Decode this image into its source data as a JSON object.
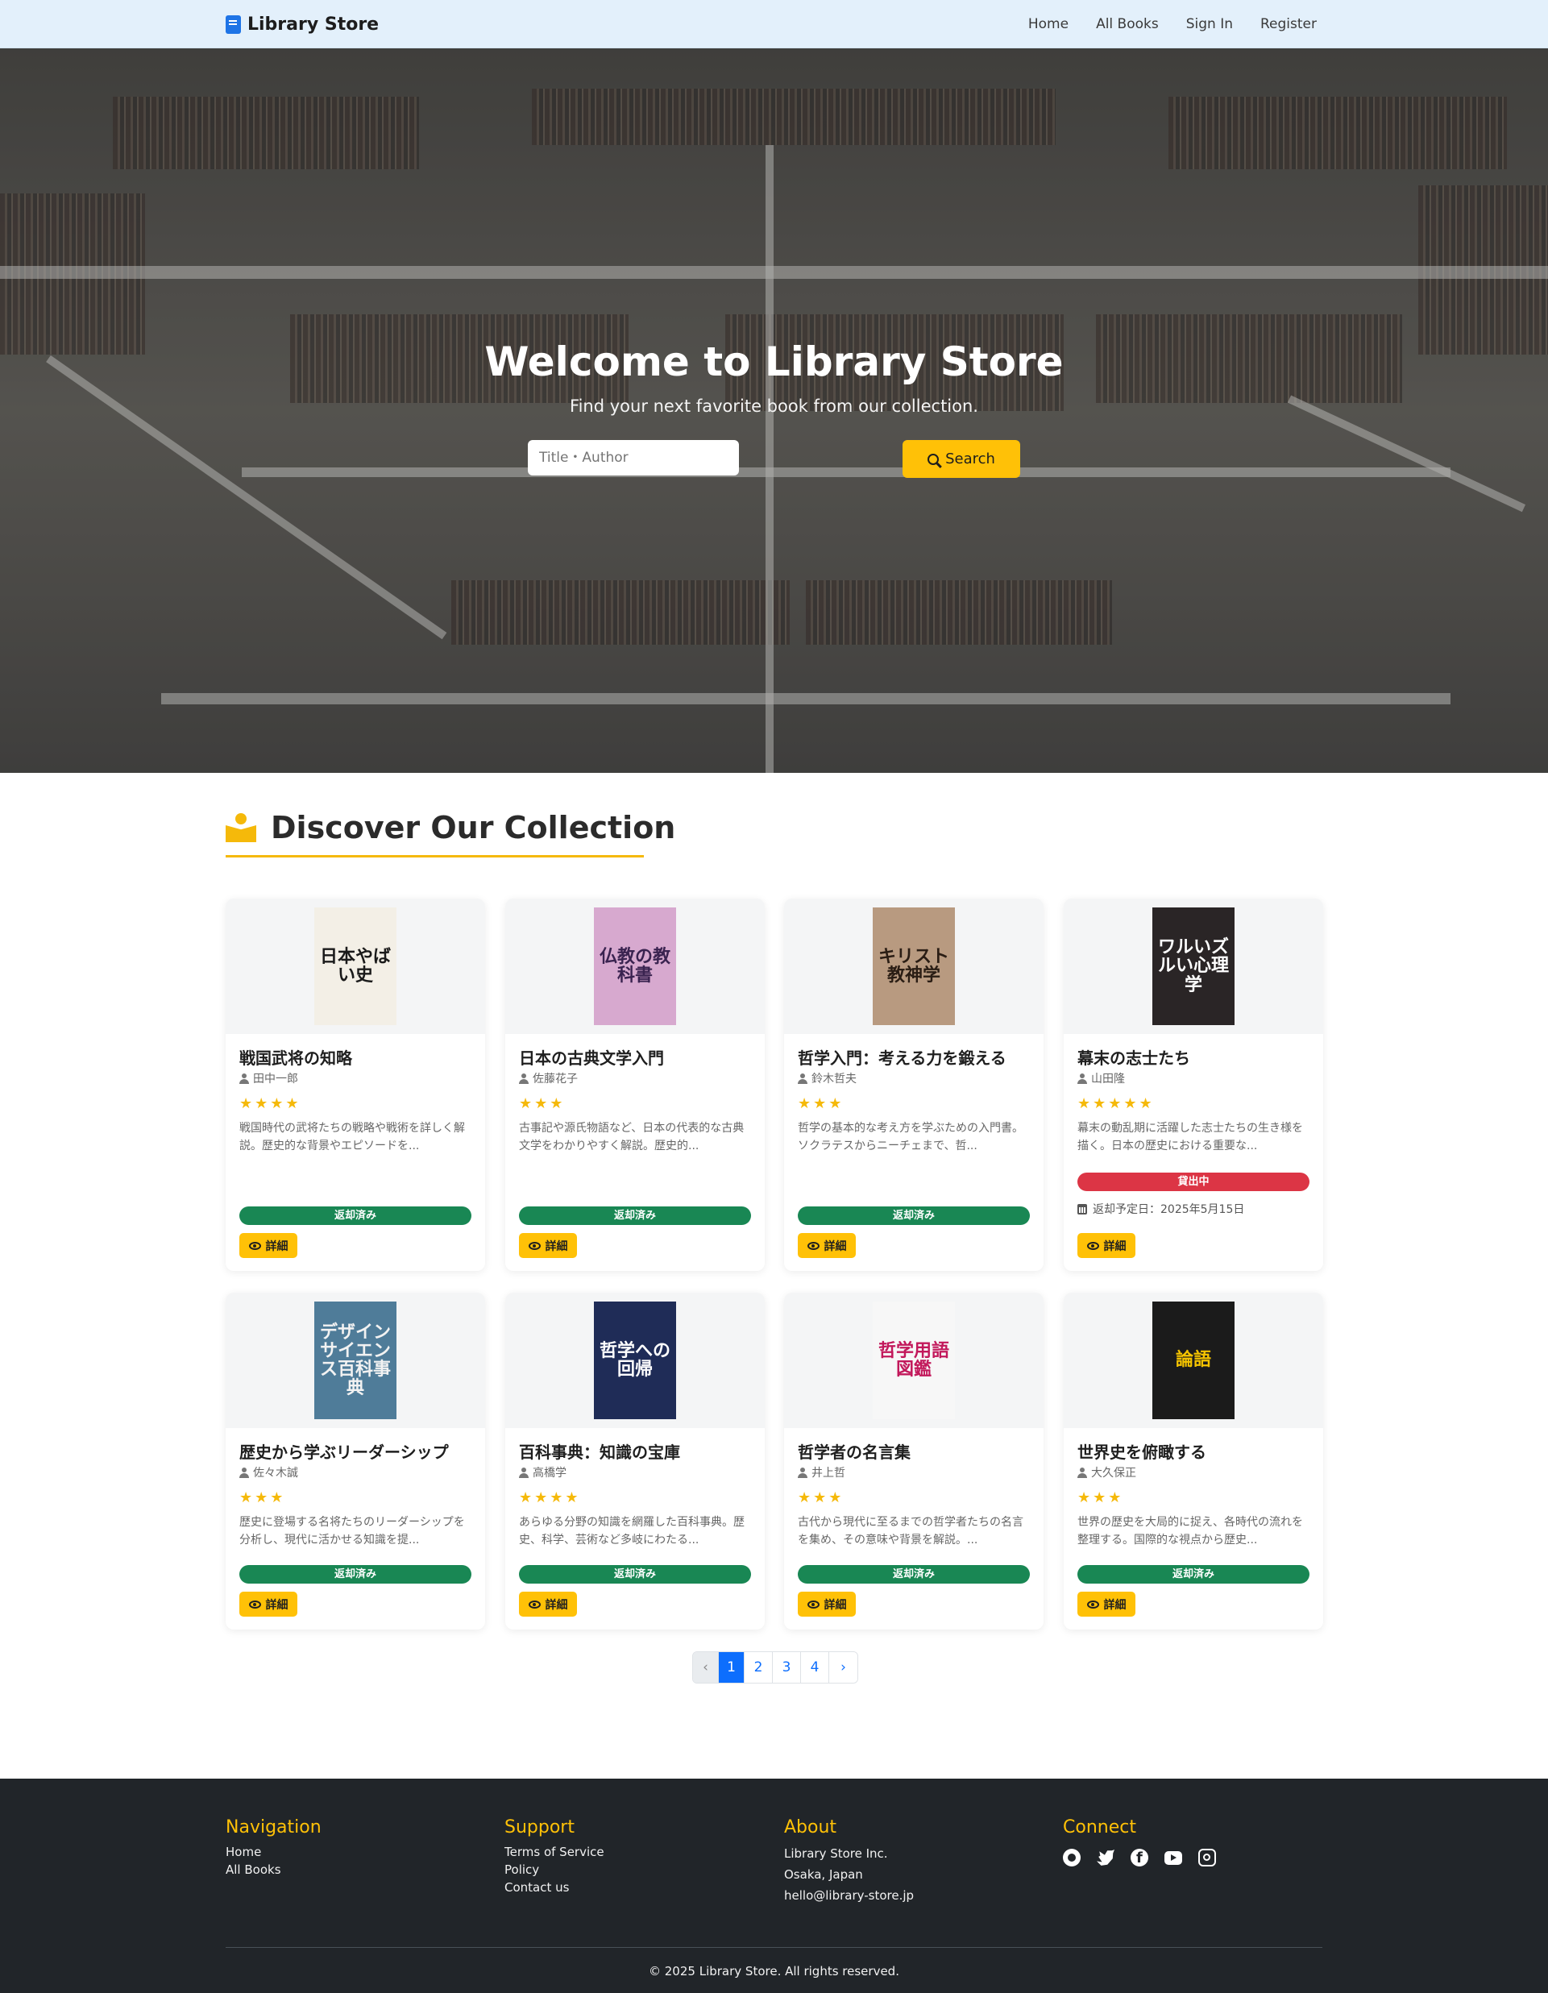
{
  "nav": {
    "brand": "Library Store",
    "links": [
      "Home",
      "All Books",
      "Sign In",
      "Register"
    ]
  },
  "hero": {
    "title": "Welcome to Library Store",
    "subtitle": "Find your next favorite book from our collection.",
    "search_placeholder": "Title・Author",
    "search_button": "Search"
  },
  "collection": {
    "heading": "Discover Our Collection",
    "books": [
      {
        "title": "戦国武将の知略",
        "author": "田中一郎",
        "rating": 4,
        "stars": "★★★★",
        "desc": "戦国時代の武将たちの戦略や戦術を詳しく解説。歴史的な背景やエピソードを...",
        "status": "返却済み",
        "status_type": "ok",
        "due": "",
        "detail": "詳細",
        "cover_text": "日本やばい史",
        "cover_bg": "#f3efe6",
        "cover_fg": "#1a1a1a"
      },
      {
        "title": "日本の古典文学入門",
        "author": "佐藤花子",
        "rating": 3,
        "stars": "★★★",
        "desc": "古事記や源氏物語など、日本の代表的な古典文学をわかりやすく解説。歴史的...",
        "status": "返却済み",
        "status_type": "ok",
        "due": "",
        "detail": "詳細",
        "cover_text": "仏教の教科書",
        "cover_bg": "#d7a9cf",
        "cover_fg": "#3a2350"
      },
      {
        "title": "哲学入門：考える力を鍛える",
        "author": "鈴木哲夫",
        "rating": 3,
        "stars": "★★★",
        "desc": "哲学の基本的な考え方を学ぶための入門書。ソクラテスからニーチェまで、哲...",
        "status": "返却済み",
        "status_type": "ok",
        "due": "",
        "detail": "詳細",
        "cover_text": "キリスト教神学",
        "cover_bg": "#b89a80",
        "cover_fg": "#2a1d14"
      },
      {
        "title": "幕末の志士たち",
        "author": "山田隆",
        "rating": 5,
        "stars": "★★★★★",
        "desc": "幕末の動乱期に活躍した志士たちの生き様を描く。日本の歴史における重要な...",
        "status": "貸出中",
        "status_type": "out",
        "due": "返却予定日：2025年5月15日",
        "detail": "詳細",
        "cover_text": "ワルいズルい心理学",
        "cover_bg": "#2a2526",
        "cover_fg": "#ffffff"
      },
      {
        "title": "歴史から学ぶリーダーシップ",
        "author": "佐々木誠",
        "rating": 3,
        "stars": "★★★",
        "desc": "歴史に登場する名将たちのリーダーシップを分析し、現代に活かせる知識を提...",
        "status": "返却済み",
        "status_type": "ok",
        "due": "",
        "detail": "詳細",
        "cover_text": "デザインサイエンス百科事典",
        "cover_bg": "#4f7c99",
        "cover_fg": "#f2f2f2"
      },
      {
        "title": "百科事典：知識の宝庫",
        "author": "高橋学",
        "rating": 4,
        "stars": "★★★★",
        "desc": "あらゆる分野の知識を網羅した百科事典。歴史、科学、芸術など多岐にわたる...",
        "status": "返却済み",
        "status_type": "ok",
        "due": "",
        "detail": "詳細",
        "cover_text": "哲学への回帰",
        "cover_bg": "#1f2c57",
        "cover_fg": "#ffffff"
      },
      {
        "title": "哲学者の名言集",
        "author": "井上哲",
        "rating": 3,
        "stars": "★★★",
        "desc": "古代から現代に至るまでの哲学者たちの名言を集め、その意味や背景を解説。...",
        "status": "返却済み",
        "status_type": "ok",
        "due": "",
        "detail": "詳細",
        "cover_text": "哲学用語図鑑",
        "cover_bg": "#f7f7f7",
        "cover_fg": "#c2185b"
      },
      {
        "title": "世界史を俯瞰する",
        "author": "大久保正",
        "rating": 3,
        "stars": "★★★",
        "desc": "世界の歴史を大局的に捉え、各時代の流れを整理する。国際的な視点から歴史...",
        "status": "返却済み",
        "status_type": "ok",
        "due": "",
        "detail": "詳細",
        "cover_text": "論語",
        "cover_bg": "#1b1b1b",
        "cover_fg": "#f5c400"
      }
    ]
  },
  "pagination": {
    "prev": "‹",
    "pages": [
      "1",
      "2",
      "3",
      "4"
    ],
    "next": "›",
    "active": "1"
  },
  "footer": {
    "nav_heading": "Navigation",
    "nav_links": [
      "Home",
      "All Books"
    ],
    "support_heading": "Support",
    "support_links": [
      "Terms of Service",
      "Policy",
      "Contact us"
    ],
    "about_heading": "About",
    "about_lines": [
      "Library Store Inc.",
      "Osaka, Japan",
      "hello@library-store.jp"
    ],
    "connect_heading": "Connect",
    "social": [
      "github-icon",
      "twitter-icon",
      "facebook-icon",
      "youtube-icon",
      "instagram-icon"
    ],
    "copyright": "© 2025 Library Store. All rights reserved."
  },
  "colors": {
    "accent": "#ffc107",
    "primary": "#0d6efd",
    "success": "#198754",
    "danger": "#dc3545",
    "footer_bg": "#212529",
    "nav_bg": "#e3f0fb"
  }
}
